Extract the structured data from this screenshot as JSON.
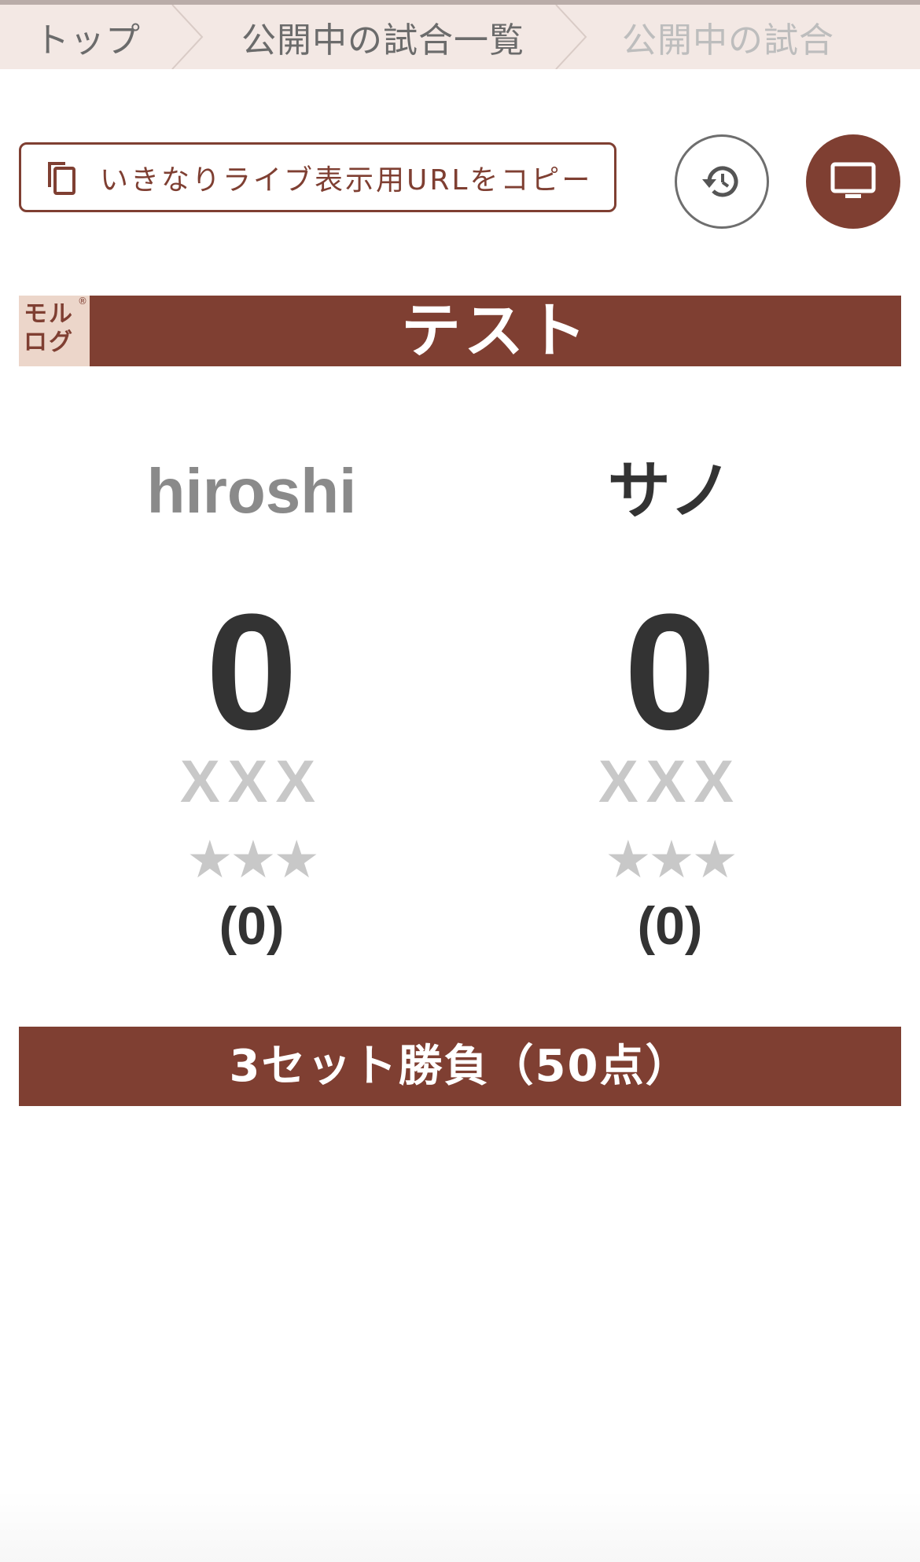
{
  "breadcrumb": {
    "items": [
      {
        "label": "トップ"
      },
      {
        "label": "公開中の試合一覧"
      },
      {
        "label": "公開中の試合"
      }
    ]
  },
  "toolbar": {
    "copy_url_label": "いきなりライブ表示用URLをコピー",
    "history_icon": "history-icon",
    "monitor_icon": "monitor-icon"
  },
  "match": {
    "logo_line1": "モル",
    "logo_line2": "ログ",
    "logo_reg": "®",
    "title": "テスト",
    "rule": "3セット勝負（50点）"
  },
  "players": [
    {
      "name": "hiroshi",
      "score": "0",
      "misses": "XXX",
      "stars": "★★★",
      "sets": "(0)"
    },
    {
      "name": "サノ",
      "score": "0",
      "misses": "XXX",
      "stars": "★★★",
      "sets": "(0)"
    }
  ],
  "colors": {
    "accent": "#7f3f32",
    "breadcrumb_bg": "#f3e8e4",
    "muted": "#c8c8c8",
    "text_dark": "#333333"
  }
}
